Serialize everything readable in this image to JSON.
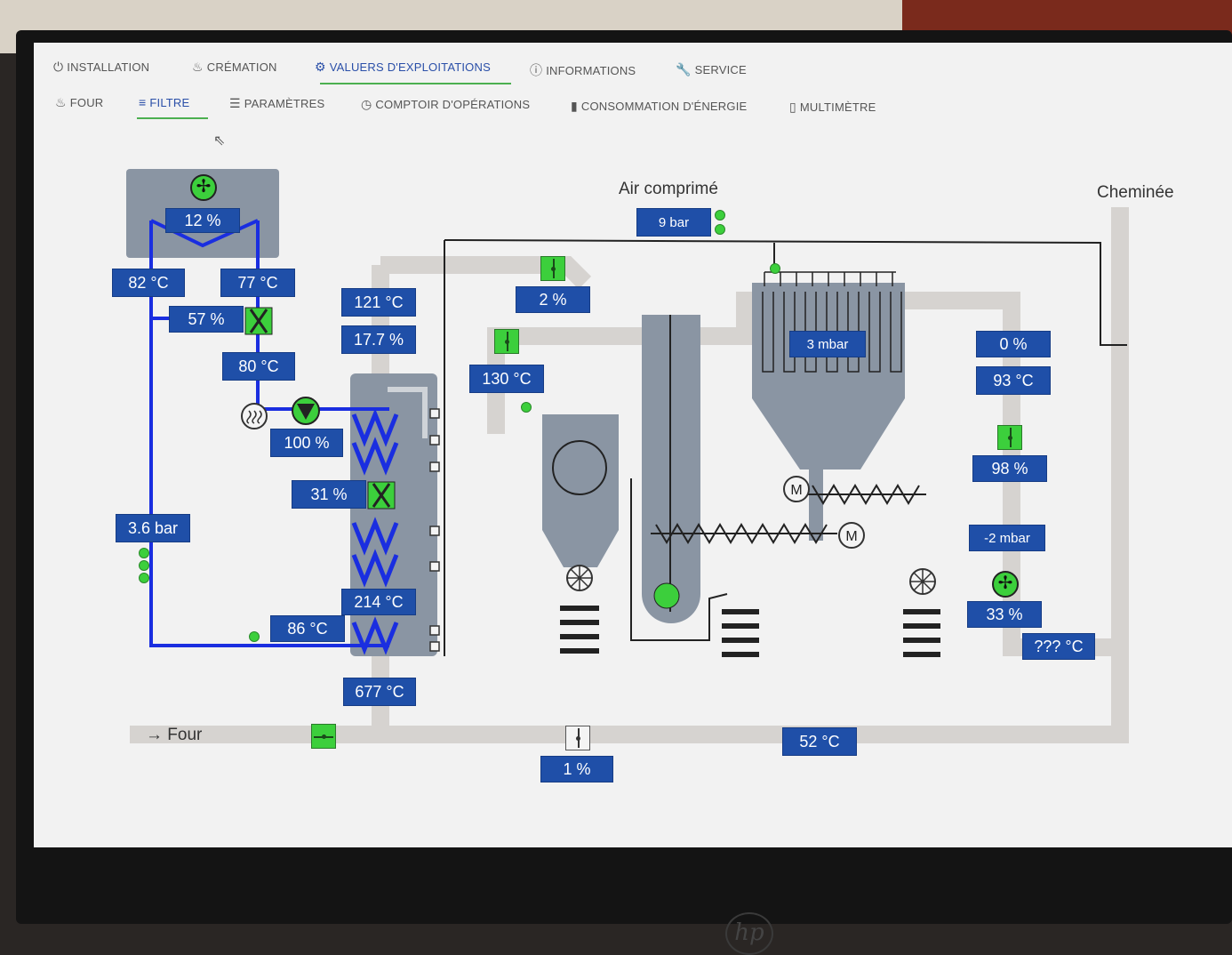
{
  "nav": {
    "main_tabs": [
      {
        "label": "INSTALLATION",
        "icon": "power-icon"
      },
      {
        "label": "CRÉMATION",
        "icon": "flame-icon"
      },
      {
        "label": "VALUERS D'EXPLOITATIONS",
        "icon": "gear-icon"
      },
      {
        "label": "INFORMATIONS",
        "icon": "info-icon"
      },
      {
        "label": "SERVICE",
        "icon": "wrench-icon"
      }
    ],
    "sub_tabs": [
      {
        "label": "FOUR",
        "icon": "flame-icon"
      },
      {
        "label": "FILTRE",
        "icon": "filter-icon"
      },
      {
        "label": "PARAMÈTRES",
        "icon": "list-icon"
      },
      {
        "label": "COMPTOIR D'OPÉRATIONS",
        "icon": "clock-icon"
      },
      {
        "label": "CONSOMMATION D'ÉNERGIE",
        "icon": "plug-icon"
      },
      {
        "label": "MULTIMÈTRE",
        "icon": "meter-icon"
      }
    ]
  },
  "labels": {
    "air": "Air comprimé",
    "chimney": "Cheminée",
    "four": "→ Four"
  },
  "values": {
    "fan_top": "12 %",
    "t82": "82 °C",
    "t77": "77 °C",
    "v57": "57 %",
    "t80": "80 °C",
    "t121": "121 °C",
    "v17": "17.7 %",
    "v100": "100 %",
    "v31": "31 %",
    "p36": "3.6 bar",
    "t214": "214 °C",
    "t86": "86 °C",
    "t677": "677 °C",
    "v2": "2 %",
    "t130": "130 °C",
    "p9": "9 bar",
    "p3mbar": "3 mbar",
    "v0": "0 %",
    "t93": "93 °C",
    "v98": "98 %",
    "pm2": "-2 mbar",
    "v33": "33 %",
    "tunk": "??? °C",
    "t52": "52 °C",
    "v1": "1 %"
  },
  "colors": {
    "accent": "#1f4fa8",
    "active_green": "#3ccf3c",
    "pipe_blue": "#1a2ee0",
    "duct_grey": "#d6d3d0",
    "equipment_grey": "#8a95a3"
  }
}
